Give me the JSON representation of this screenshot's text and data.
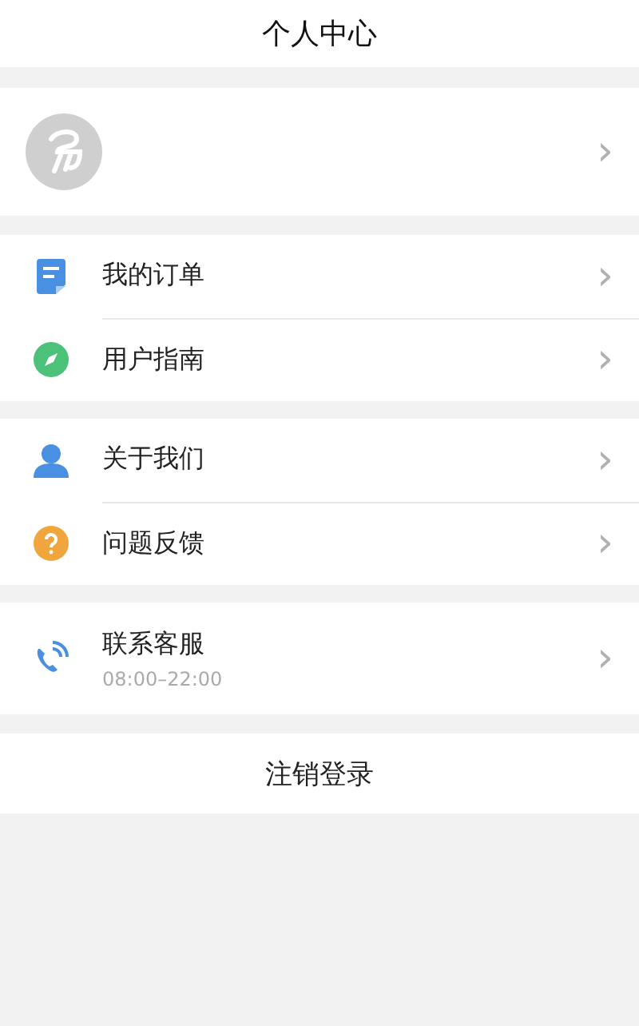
{
  "header": {
    "title": "个人中心"
  },
  "profile": {
    "chevron": "›"
  },
  "groups": [
    {
      "items": [
        {
          "kind": "document",
          "label": "我的订单"
        },
        {
          "kind": "compass",
          "label": "用户指南"
        }
      ]
    },
    {
      "items": [
        {
          "kind": "person",
          "label": "关于我们"
        },
        {
          "kind": "question",
          "label": "问题反馈"
        }
      ]
    },
    {
      "items": [
        {
          "kind": "phone",
          "label": "联系客服",
          "sub": "08:00–22:00"
        }
      ]
    }
  ],
  "logout": {
    "label": "注销登录"
  }
}
